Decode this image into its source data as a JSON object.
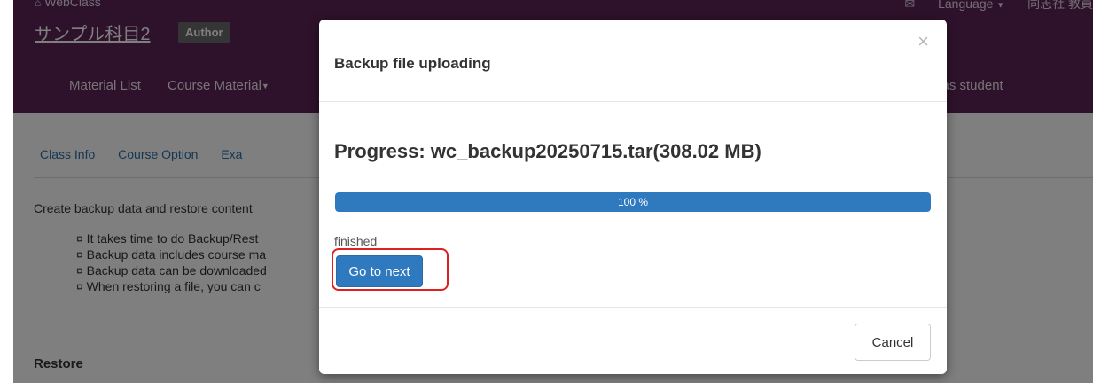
{
  "header": {
    "brand": "WebClass",
    "course_title": "サンプル科目2",
    "role_badge": "Author",
    "language_label": "Language",
    "user_label": "同志社 教員"
  },
  "nav": {
    "items": [
      {
        "label": "Material List"
      },
      {
        "label": "Course Material"
      }
    ],
    "right_label": "n as student"
  },
  "subtabs": [
    {
      "label": "Class Info"
    },
    {
      "label": "Course Option"
    },
    {
      "label": "Exa"
    }
  ],
  "page": {
    "description": "Create backup data and restore content",
    "bullets": [
      "¤ It takes time to do Backup/Rest",
      "¤ Backup data includes course ma",
      "¤ Backup data can be downloaded",
      "¤ When restoring a file, you can c"
    ],
    "restore_heading": "Restore"
  },
  "modal": {
    "title": "Backup file uploading",
    "close_symbol": "×",
    "progress_heading": "Progress: wc_backup20250715.tar(308.02 MB)",
    "progress_percent": 100,
    "progress_label": "100 %",
    "status": "finished",
    "next_button": "Go to next",
    "cancel_button": "Cancel"
  },
  "colors": {
    "header_bg": "#5c2457",
    "accent_blue": "#2f79be",
    "highlight_red": "#e02020"
  },
  "icons": {
    "brand": "home-icon",
    "top_right": "mail-icon",
    "dropdown": "caret-down-icon"
  }
}
